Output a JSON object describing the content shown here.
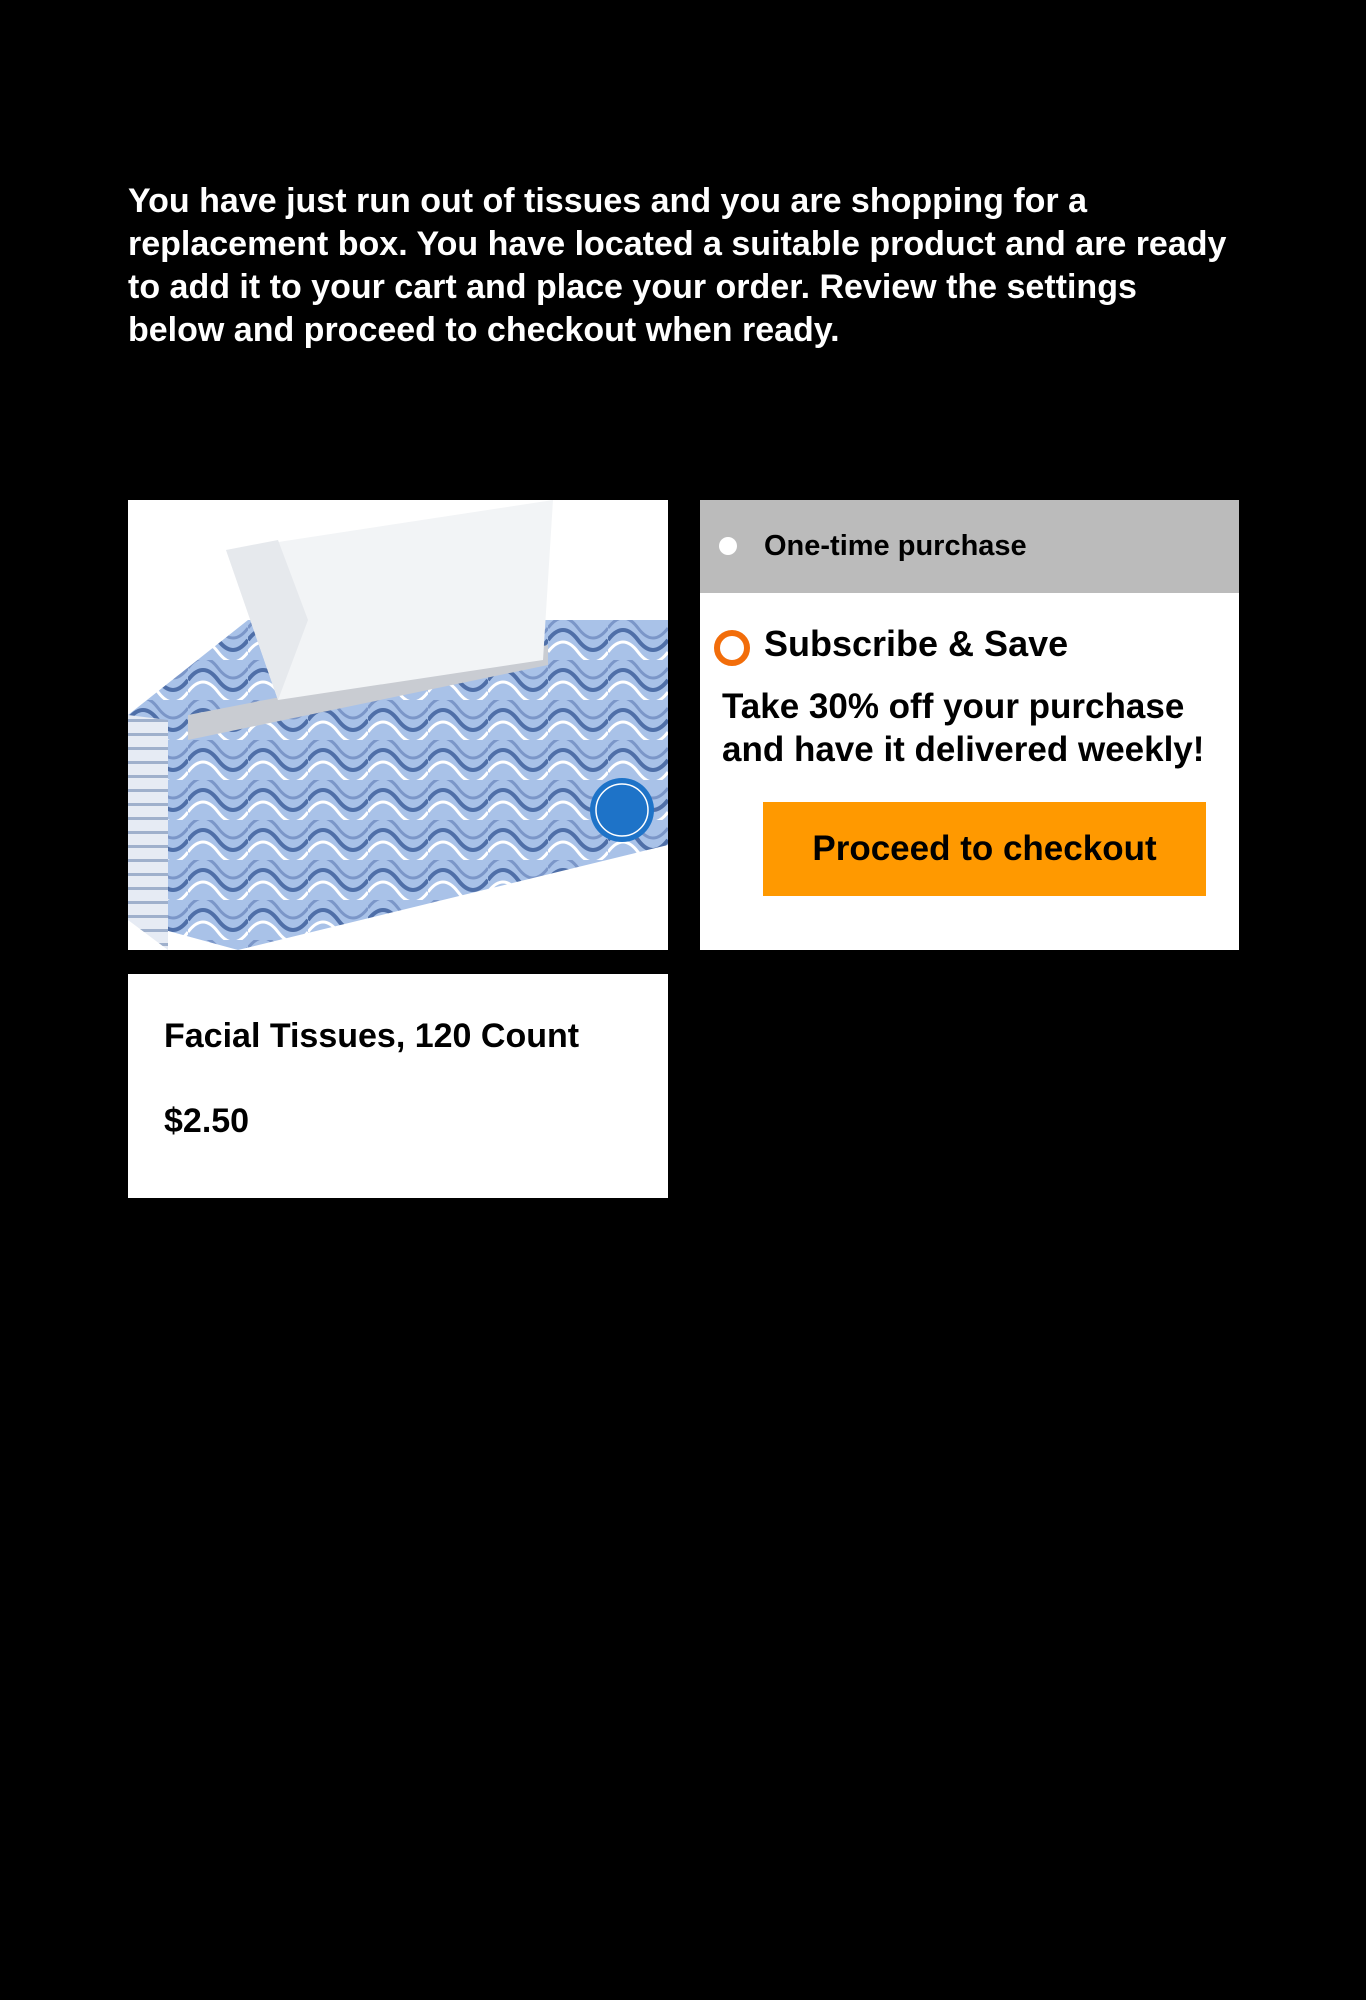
{
  "instructions": {
    "text": "You have just run out of tissues and you are shopping for a replacement box. You have located a suitable product and are ready to add it to your cart and place your order. Review the settings below and proceed to checkout when ready."
  },
  "product": {
    "image_icon": "tissue-box-image",
    "name": "Facial Tissues, 120 Count",
    "price": "$2.50"
  },
  "purchase_options": {
    "one_time": {
      "label": "One-time purchase",
      "selected": false
    },
    "subscribe": {
      "label": "Subscribe & Save",
      "description": "Take 30% off your purchase and have it delivered weekly!",
      "selected": true
    }
  },
  "checkout": {
    "label": "Proceed to checkout"
  },
  "colors": {
    "background": "#000000",
    "checkout_button": "#ff9900",
    "selected_radio": "#f26d0a",
    "unselected_option_bg": "#bbbbbb"
  }
}
